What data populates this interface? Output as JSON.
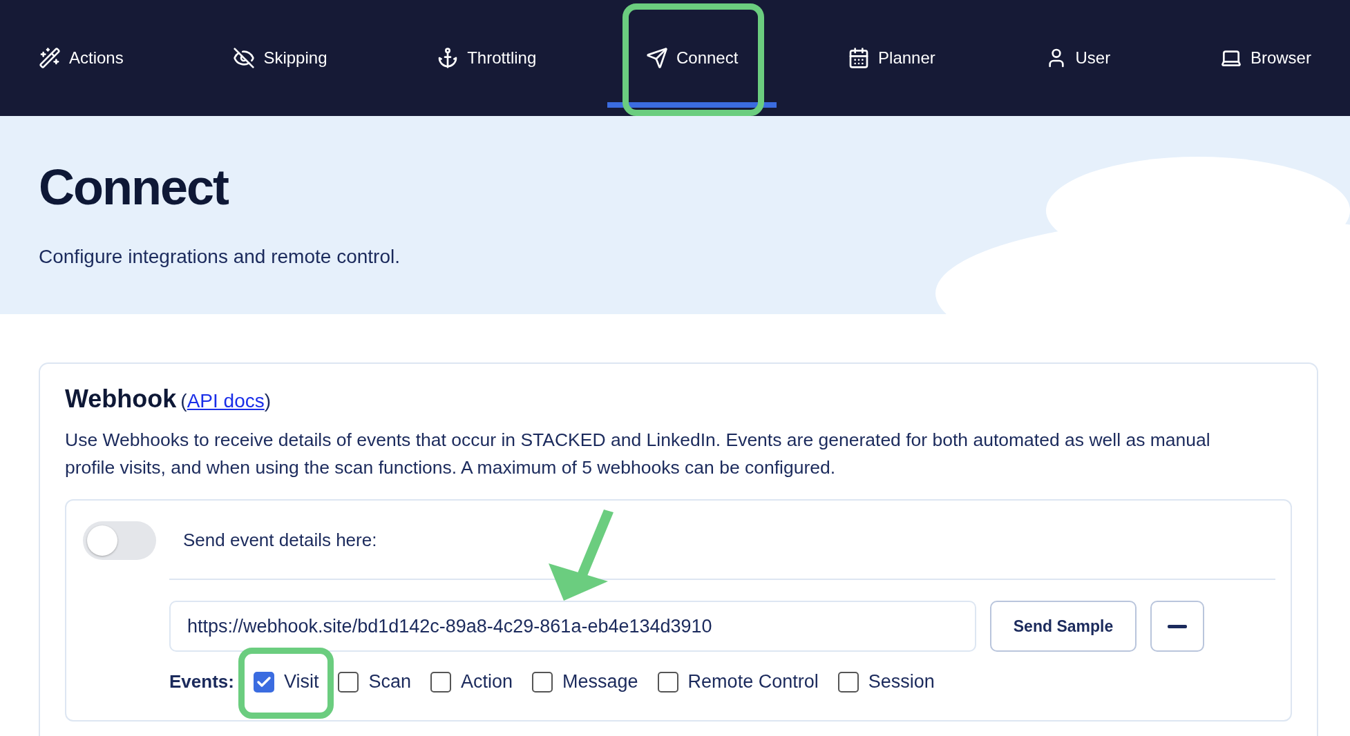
{
  "nav": {
    "tabs": [
      {
        "label": "Actions",
        "selected": false,
        "highlighted": false
      },
      {
        "label": "Skipping",
        "selected": false,
        "highlighted": false
      },
      {
        "label": "Throttling",
        "selected": false,
        "highlighted": false
      },
      {
        "label": "Connect",
        "selected": true,
        "highlighted": true
      },
      {
        "label": "Planner",
        "selected": false,
        "highlighted": false
      },
      {
        "label": "User",
        "selected": false,
        "highlighted": false
      },
      {
        "label": "Browser",
        "selected": false,
        "highlighted": false
      }
    ]
  },
  "header": {
    "title": "Connect",
    "subtitle": "Configure integrations and remote control."
  },
  "webhook": {
    "title": "Webhook",
    "link_prefix": "(",
    "link": "API docs",
    "link_suffix": ")",
    "description": "Use Webhooks to receive details of events that occur in STACKED and LinkedIn. Events are generated for both automated as well as manual profile visits, and when using the scan functions. A maximum of 5 webhooks can be configured.",
    "entry": {
      "enabled": false,
      "label": "Send event details here:",
      "url": "https://webhook.site/bd1d142c-89a8-4c29-861a-eb4e134d3910",
      "send_button": "Send Sample",
      "events_label": "Events:",
      "events": [
        {
          "label": "Visit",
          "checked": true,
          "highlighted": true
        },
        {
          "label": "Scan",
          "checked": false,
          "highlighted": false
        },
        {
          "label": "Action",
          "checked": false,
          "highlighted": false
        },
        {
          "label": "Message",
          "checked": false,
          "highlighted": false
        },
        {
          "label": "Remote Control",
          "checked": false,
          "highlighted": false
        },
        {
          "label": "Session",
          "checked": false,
          "highlighted": false
        }
      ]
    }
  }
}
